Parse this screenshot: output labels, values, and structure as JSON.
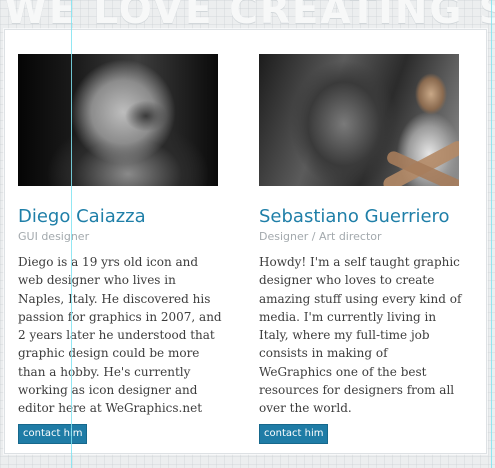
{
  "banner": {
    "text": "WE LOVE CREATING STUFF"
  },
  "people": [
    {
      "name": "Diego Caiazza",
      "role": "GUI designer",
      "bio": "Diego is a 19 yrs old icon and web designer who lives in Naples, Italy. He discovered his passion for graphics in 2007, and 2 years later he understood that graphic design could be more than a hobby. He's currently working as icon designer and editor here at WeGraphics.net",
      "contact_label": "contact him"
    },
    {
      "name": "Sebastiano Guerriero",
      "role": "Designer / Art director",
      "bio": "Howdy! I'm a self taught graphic designer who loves to create amazing stuff using every kind of media. I'm currently living in Italy, where my full-time job consists in making of WeGraphics one of the best resources for designers from all over the world.",
      "contact_label": "contact him"
    }
  ],
  "colors": {
    "accent": "#1f7fa8",
    "button": "#1f7ca6",
    "role_text": "#a3a9ad",
    "guide": "#7fe3f1"
  }
}
